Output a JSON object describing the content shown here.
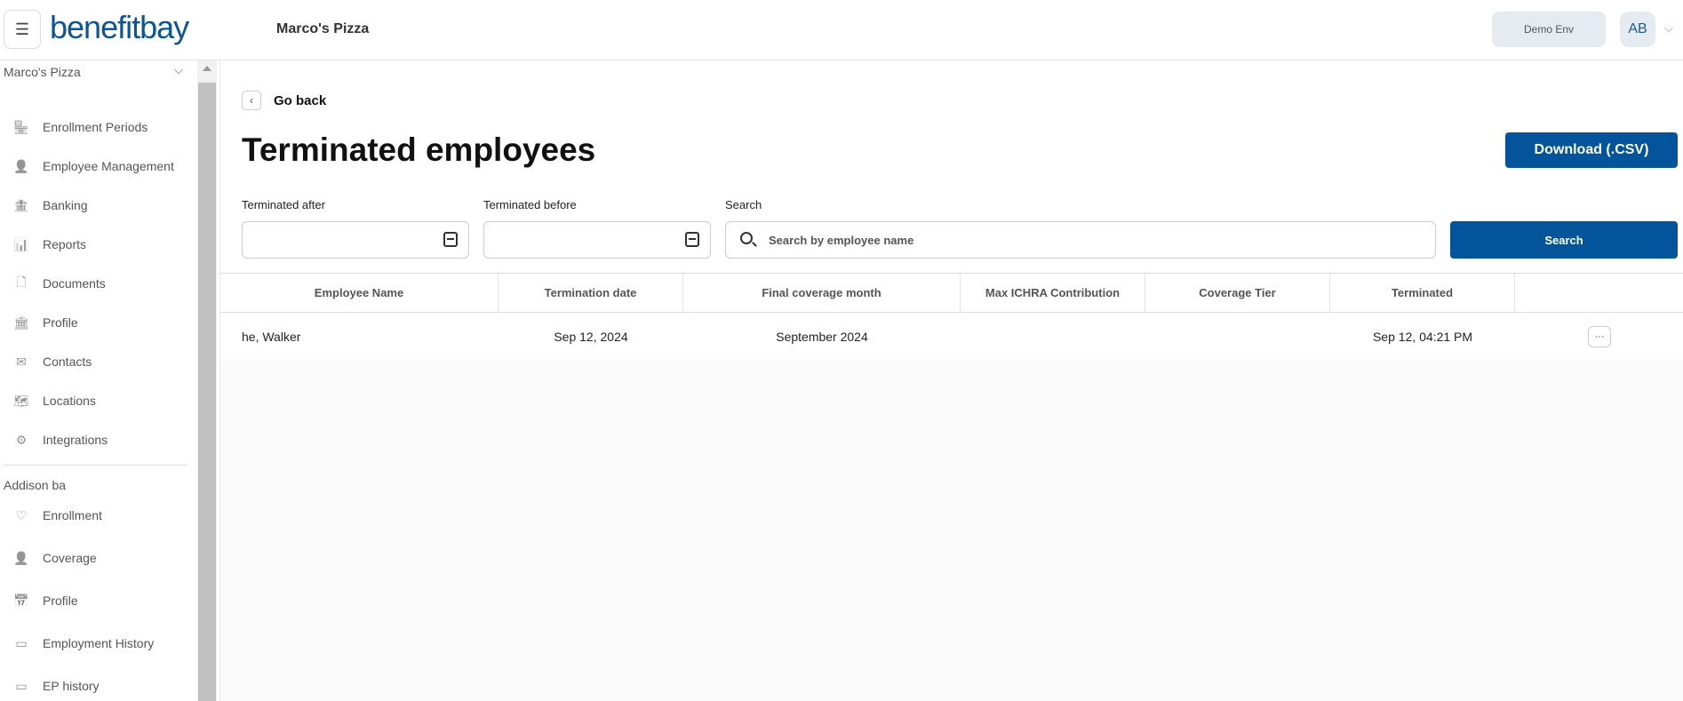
{
  "header": {
    "logo": "benefitbay",
    "company": "Marco's Pizza",
    "env": "Demo Env",
    "avatar": "AB"
  },
  "sidebar": {
    "company_group": "Marco's Pizza",
    "company_items": [
      {
        "label": "Enrollment Periods",
        "icon": "store-icon"
      },
      {
        "label": "Employee Management",
        "icon": "user-gear-icon"
      },
      {
        "label": "Banking",
        "icon": "bank-icon"
      },
      {
        "label": "Reports",
        "icon": "report-icon"
      },
      {
        "label": "Documents",
        "icon": "document-icon"
      },
      {
        "label": "Profile",
        "icon": "building-icon"
      },
      {
        "label": "Contacts",
        "icon": "mail-icon"
      },
      {
        "label": "Locations",
        "icon": "map-icon"
      },
      {
        "label": "Integrations",
        "icon": "integrations-icon"
      }
    ],
    "user_group": "Addison ba",
    "user_items": [
      {
        "label": "Enrollment",
        "icon": "heart-icon"
      },
      {
        "label": "Coverage",
        "icon": "user-heart-icon"
      },
      {
        "label": "Profile",
        "icon": "profile-calendar-icon"
      },
      {
        "label": "Employment History",
        "icon": "calendar-icon"
      },
      {
        "label": "EP history",
        "icon": "calendar-icon"
      }
    ]
  },
  "main": {
    "back": "Go back",
    "title": "Terminated employees",
    "download": "Download (.CSV)",
    "filters": {
      "after_label": "Terminated after",
      "before_label": "Terminated before",
      "search_label": "Search",
      "search_placeholder": "Search by employee name",
      "search_button": "Search"
    },
    "table": {
      "columns": [
        "Employee Name",
        "Termination date",
        "Final coverage month",
        "Max ICHRA Contribution",
        "Coverage Tier",
        "Terminated",
        ""
      ],
      "rows": [
        [
          "he, Walker",
          "Sep 12, 2024",
          "September 2024",
          "",
          "",
          "Sep 12, 04:21 PM"
        ]
      ],
      "more": "···"
    }
  }
}
